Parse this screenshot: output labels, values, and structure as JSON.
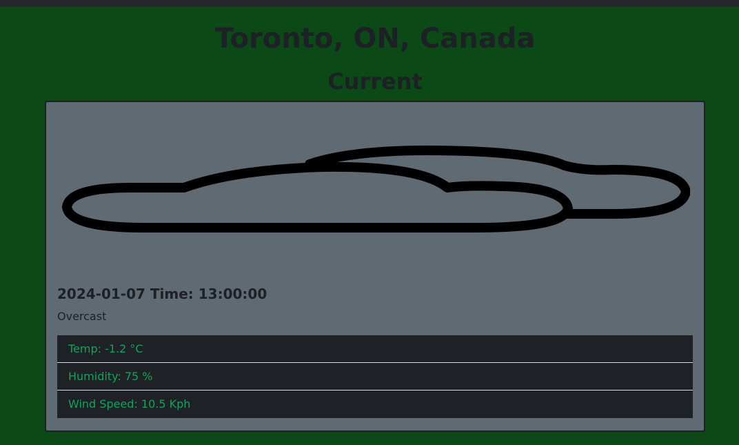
{
  "location": "Toronto, ON, Canada",
  "section": "Current",
  "weather": {
    "icon": "cloud-icon",
    "date": "2024-01-07",
    "time_label": "Time:",
    "time": "13:00:00",
    "datetime_text": "2024-01-07 Time: 13:00:00",
    "condition": "Overcast",
    "temp": "Temp: -1.2 °C",
    "humidity": "Humidity: 75 %",
    "wind": "Wind Speed: 10.5 Kph"
  },
  "colors": {
    "background": "#0b4a16",
    "card": "#5f6a72",
    "stat_text": "#13a35a",
    "stat_bg": "#1e2125"
  }
}
